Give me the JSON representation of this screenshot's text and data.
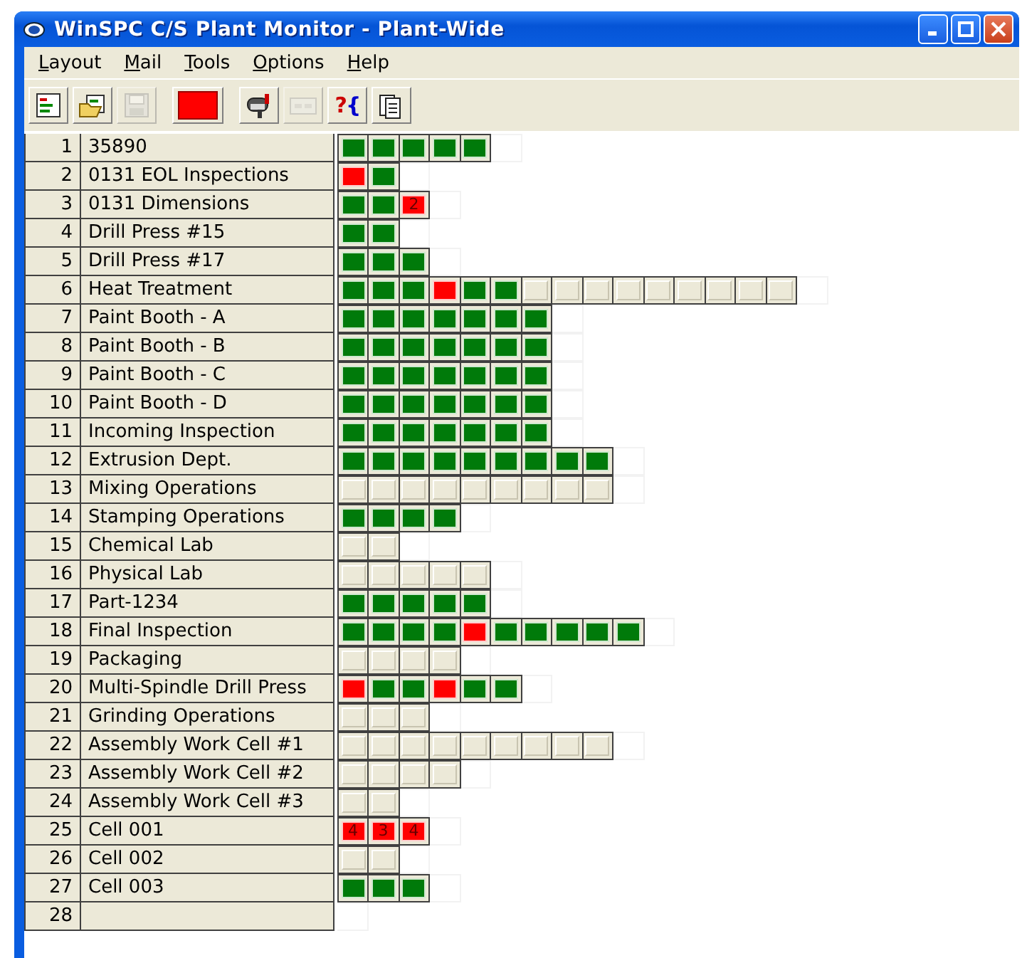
{
  "window": {
    "title": "WinSPC C/S Plant Monitor - Plant-Wide"
  },
  "menu": [
    {
      "mnemonic": "L",
      "rest": "ayout"
    },
    {
      "mnemonic": "M",
      "rest": "ail"
    },
    {
      "mnemonic": "T",
      "rest": "ools"
    },
    {
      "mnemonic": "O",
      "rest": "ptions"
    },
    {
      "mnemonic": "H",
      "rest": "elp"
    }
  ],
  "toolbar": [
    {
      "kind": "list",
      "disabled": false
    },
    {
      "kind": "open",
      "disabled": false
    },
    {
      "kind": "save",
      "disabled": true
    },
    {
      "kind": "alarm",
      "disabled": false
    },
    {
      "kind": "mailbox",
      "disabled": false
    },
    {
      "kind": "panel",
      "disabled": true
    },
    {
      "kind": "help",
      "disabled": false,
      "text": "?{"
    },
    {
      "kind": "pages",
      "disabled": false
    }
  ],
  "rows": [
    {
      "number": "1",
      "name": "35890",
      "cells": [
        {
          "kind": "ok"
        },
        {
          "kind": "ok"
        },
        {
          "kind": "ok"
        },
        {
          "kind": "ok"
        },
        {
          "kind": "ok"
        }
      ]
    },
    {
      "number": "2",
      "name": "0131 EOL Inspections",
      "cells": [
        {
          "kind": "alarm"
        },
        {
          "kind": "ok"
        }
      ]
    },
    {
      "number": "3",
      "name": "0131 Dimensions",
      "cells": [
        {
          "kind": "ok"
        },
        {
          "kind": "ok"
        },
        {
          "kind": "alarm",
          "count": "2"
        }
      ]
    },
    {
      "number": "4",
      "name": "Drill Press #15",
      "cells": [
        {
          "kind": "ok"
        },
        {
          "kind": "ok"
        }
      ]
    },
    {
      "number": "5",
      "name": "Drill Press #17",
      "cells": [
        {
          "kind": "ok"
        },
        {
          "kind": "ok"
        },
        {
          "kind": "ok"
        }
      ]
    },
    {
      "number": "6",
      "name": "Heat Treatment",
      "cells": [
        {
          "kind": "ok"
        },
        {
          "kind": "ok"
        },
        {
          "kind": "ok"
        },
        {
          "kind": "alarm"
        },
        {
          "kind": "ok"
        },
        {
          "kind": "ok"
        },
        {
          "kind": "idle"
        },
        {
          "kind": "idle"
        },
        {
          "kind": "idle"
        },
        {
          "kind": "idle"
        },
        {
          "kind": "idle"
        },
        {
          "kind": "idle"
        },
        {
          "kind": "idle"
        },
        {
          "kind": "idle"
        },
        {
          "kind": "idle"
        }
      ]
    },
    {
      "number": "7",
      "name": "Paint Booth - A",
      "cells": [
        {
          "kind": "ok"
        },
        {
          "kind": "ok"
        },
        {
          "kind": "ok"
        },
        {
          "kind": "ok"
        },
        {
          "kind": "ok"
        },
        {
          "kind": "ok"
        },
        {
          "kind": "ok"
        }
      ]
    },
    {
      "number": "8",
      "name": "Paint Booth - B",
      "cells": [
        {
          "kind": "ok"
        },
        {
          "kind": "ok"
        },
        {
          "kind": "ok"
        },
        {
          "kind": "ok"
        },
        {
          "kind": "ok"
        },
        {
          "kind": "ok"
        },
        {
          "kind": "ok"
        }
      ]
    },
    {
      "number": "9",
      "name": "Paint Booth - C",
      "cells": [
        {
          "kind": "ok"
        },
        {
          "kind": "ok"
        },
        {
          "kind": "ok"
        },
        {
          "kind": "ok"
        },
        {
          "kind": "ok"
        },
        {
          "kind": "ok"
        },
        {
          "kind": "ok"
        }
      ]
    },
    {
      "number": "10",
      "name": "Paint Booth - D",
      "cells": [
        {
          "kind": "ok"
        },
        {
          "kind": "ok"
        },
        {
          "kind": "ok"
        },
        {
          "kind": "ok"
        },
        {
          "kind": "ok"
        },
        {
          "kind": "ok"
        },
        {
          "kind": "ok"
        }
      ]
    },
    {
      "number": "11",
      "name": "Incoming Inspection",
      "cells": [
        {
          "kind": "ok"
        },
        {
          "kind": "ok"
        },
        {
          "kind": "ok"
        },
        {
          "kind": "ok"
        },
        {
          "kind": "ok"
        },
        {
          "kind": "ok"
        },
        {
          "kind": "ok"
        }
      ]
    },
    {
      "number": "12",
      "name": "Extrusion Dept.",
      "cells": [
        {
          "kind": "ok"
        },
        {
          "kind": "ok"
        },
        {
          "kind": "ok"
        },
        {
          "kind": "ok"
        },
        {
          "kind": "ok"
        },
        {
          "kind": "ok"
        },
        {
          "kind": "ok"
        },
        {
          "kind": "ok"
        },
        {
          "kind": "ok"
        }
      ]
    },
    {
      "number": "13",
      "name": "Mixing Operations",
      "cells": [
        {
          "kind": "idle"
        },
        {
          "kind": "idle"
        },
        {
          "kind": "idle"
        },
        {
          "kind": "idle"
        },
        {
          "kind": "idle"
        },
        {
          "kind": "idle"
        },
        {
          "kind": "idle"
        },
        {
          "kind": "idle"
        },
        {
          "kind": "idle"
        }
      ]
    },
    {
      "number": "14",
      "name": "Stamping Operations",
      "cells": [
        {
          "kind": "ok"
        },
        {
          "kind": "ok"
        },
        {
          "kind": "ok"
        },
        {
          "kind": "ok"
        }
      ]
    },
    {
      "number": "15",
      "name": "Chemical Lab",
      "cells": [
        {
          "kind": "idle"
        },
        {
          "kind": "idle"
        }
      ]
    },
    {
      "number": "16",
      "name": "Physical Lab",
      "cells": [
        {
          "kind": "idle"
        },
        {
          "kind": "idle"
        },
        {
          "kind": "idle"
        },
        {
          "kind": "idle"
        },
        {
          "kind": "idle"
        }
      ]
    },
    {
      "number": "17",
      "name": "Part-1234",
      "cells": [
        {
          "kind": "ok"
        },
        {
          "kind": "ok"
        },
        {
          "kind": "ok"
        },
        {
          "kind": "ok"
        },
        {
          "kind": "ok"
        }
      ]
    },
    {
      "number": "18",
      "name": "Final Inspection",
      "cells": [
        {
          "kind": "ok"
        },
        {
          "kind": "ok"
        },
        {
          "kind": "ok"
        },
        {
          "kind": "ok"
        },
        {
          "kind": "alarm"
        },
        {
          "kind": "ok"
        },
        {
          "kind": "ok"
        },
        {
          "kind": "ok"
        },
        {
          "kind": "ok"
        },
        {
          "kind": "ok"
        }
      ]
    },
    {
      "number": "19",
      "name": "Packaging",
      "cells": [
        {
          "kind": "idle"
        },
        {
          "kind": "idle"
        },
        {
          "kind": "idle"
        },
        {
          "kind": "idle"
        }
      ]
    },
    {
      "number": "20",
      "name": "Multi-Spindle Drill Press",
      "cells": [
        {
          "kind": "alarm"
        },
        {
          "kind": "ok"
        },
        {
          "kind": "ok"
        },
        {
          "kind": "alarm"
        },
        {
          "kind": "ok"
        },
        {
          "kind": "ok"
        }
      ]
    },
    {
      "number": "21",
      "name": "Grinding Operations",
      "cells": [
        {
          "kind": "idle"
        },
        {
          "kind": "idle"
        },
        {
          "kind": "idle"
        }
      ]
    },
    {
      "number": "22",
      "name": "Assembly Work Cell #1",
      "cells": [
        {
          "kind": "idle"
        },
        {
          "kind": "idle"
        },
        {
          "kind": "idle"
        },
        {
          "kind": "idle"
        },
        {
          "kind": "idle"
        },
        {
          "kind": "idle"
        },
        {
          "kind": "idle"
        },
        {
          "kind": "idle"
        },
        {
          "kind": "idle"
        }
      ]
    },
    {
      "number": "23",
      "name": "Assembly Work Cell #2",
      "cells": [
        {
          "kind": "idle"
        },
        {
          "kind": "idle"
        },
        {
          "kind": "idle"
        },
        {
          "kind": "idle"
        }
      ]
    },
    {
      "number": "24",
      "name": "Assembly Work Cell #3",
      "cells": [
        {
          "kind": "idle"
        },
        {
          "kind": "idle"
        }
      ]
    },
    {
      "number": "25",
      "name": "Cell 001",
      "cells": [
        {
          "kind": "alarm",
          "count": "4"
        },
        {
          "kind": "alarm",
          "count": "3"
        },
        {
          "kind": "alarm",
          "count": "4"
        }
      ]
    },
    {
      "number": "26",
      "name": "Cell 002",
      "cells": [
        {
          "kind": "idle"
        },
        {
          "kind": "idle"
        }
      ]
    },
    {
      "number": "27",
      "name": "Cell 003",
      "cells": [
        {
          "kind": "ok"
        },
        {
          "kind": "ok"
        },
        {
          "kind": "ok"
        }
      ]
    },
    {
      "number": "28"
    }
  ]
}
